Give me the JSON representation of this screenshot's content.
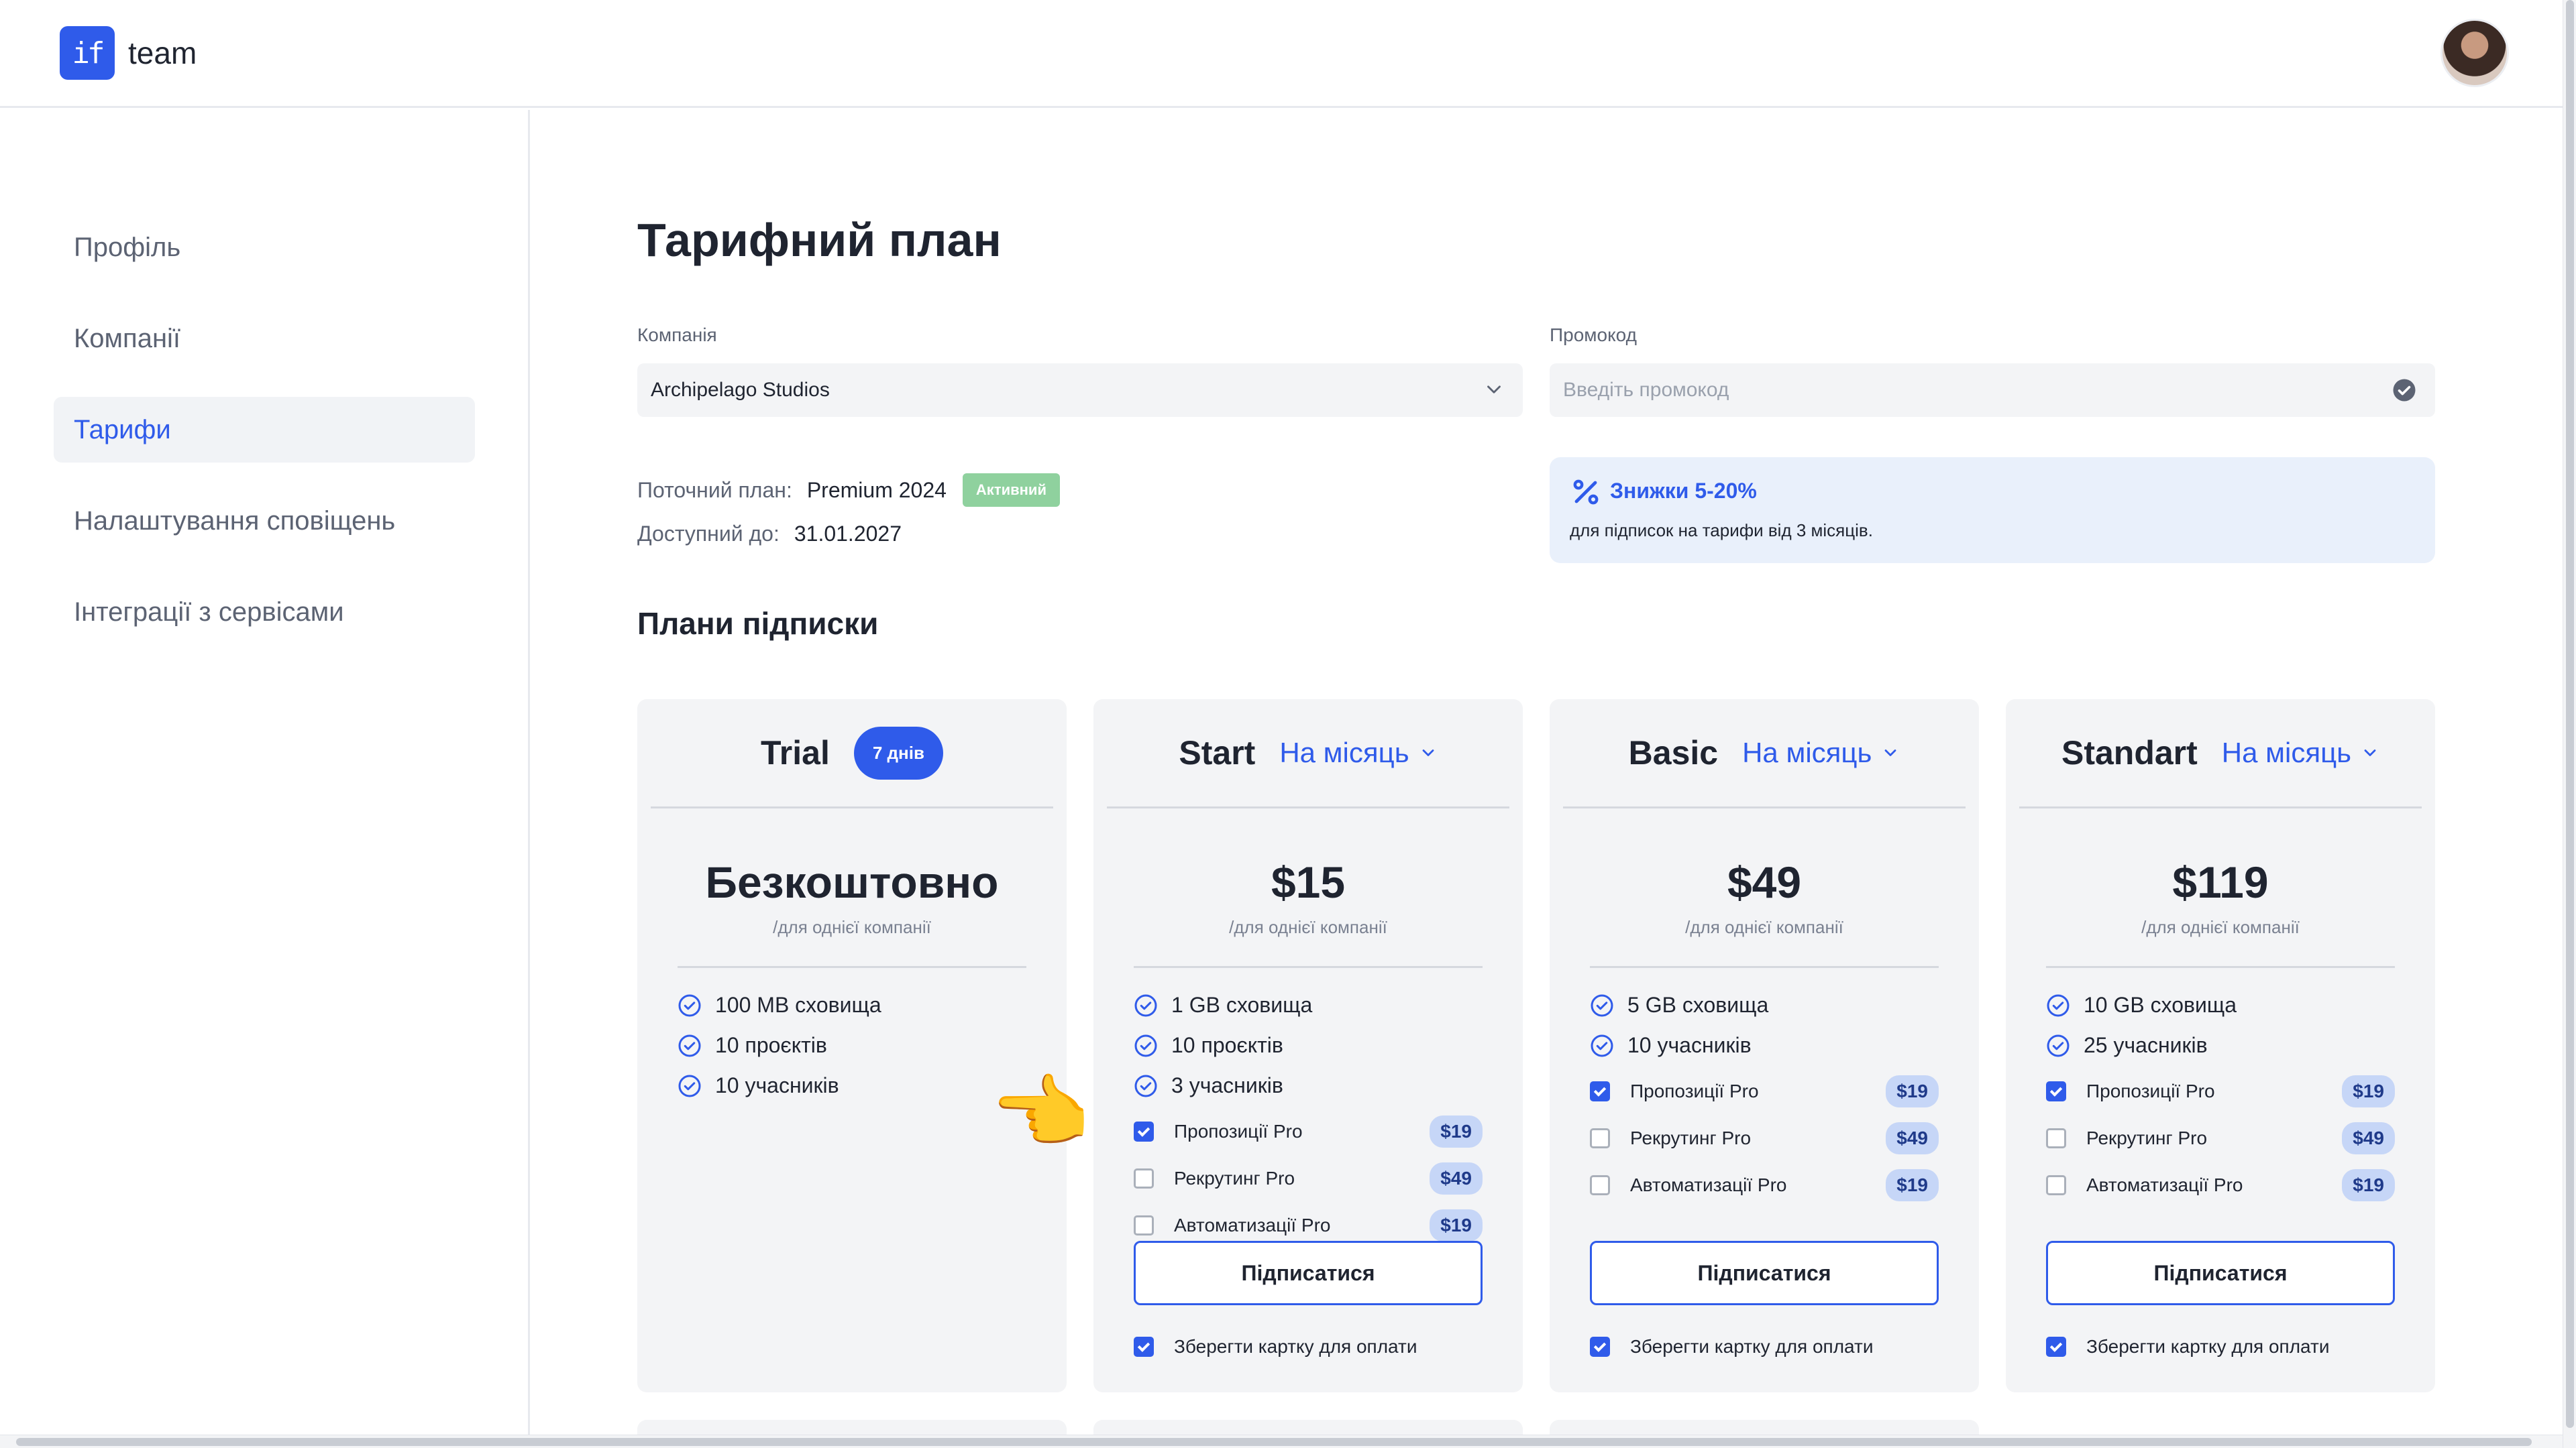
{
  "app": {
    "logo_mark": "if",
    "logo_text": "team"
  },
  "sidebar": {
    "items": [
      {
        "label": "Профіль"
      },
      {
        "label": "Компанії"
      },
      {
        "label": "Тарифи"
      },
      {
        "label": "Налаштування сповіщень"
      },
      {
        "label": "Інтеграції з сервісами"
      }
    ]
  },
  "main": {
    "title": "Тарифний план",
    "company": {
      "label": "Компанія",
      "value": "Archipelago Studios"
    },
    "promo": {
      "label": "Промокод",
      "placeholder": "Введіть промокод"
    },
    "current_plan": {
      "label": "Поточний план:",
      "value": "Premium 2024",
      "status": "Активний"
    },
    "available_until": {
      "label": "Доступний до:",
      "value": "31.01.2027"
    },
    "discount": {
      "title": "Знижки 5-20%",
      "description": "для підписок на тарифи від 3 місяців."
    },
    "plans_title": "Плани підписки"
  },
  "plans": [
    {
      "name": "Trial",
      "badge": "7 днів",
      "price": "Безкоштовно",
      "per": "/для однієї компанії",
      "features": [
        "100 MB сховища",
        "10 проєктів",
        "10 учасників"
      ]
    },
    {
      "name": "Start",
      "period": "На місяць",
      "price": "$15",
      "per": "/для однієї компанії",
      "features": [
        "1 GB сховища",
        "10 проєктів",
        "3 учасників"
      ],
      "addons": [
        {
          "label": "Пропозиції Pro",
          "price": "$19",
          "checked": true
        },
        {
          "label": "Рекрутинг Pro",
          "price": "$49",
          "checked": false
        },
        {
          "label": "Автоматизації Pro",
          "price": "$19",
          "checked": false
        }
      ],
      "subscribe": "Підписатися",
      "save_card": "Зберегти картку для оплати"
    },
    {
      "name": "Basic",
      "period": "На місяць",
      "price": "$49",
      "per": "/для однієї компанії",
      "features": [
        "5 GB сховища",
        "10 учасників"
      ],
      "addons": [
        {
          "label": "Пропозиції Pro",
          "price": "$19",
          "checked": true
        },
        {
          "label": "Рекрутинг Pro",
          "price": "$49",
          "checked": false
        },
        {
          "label": "Автоматизації Pro",
          "price": "$19",
          "checked": false
        }
      ],
      "subscribe": "Підписатися",
      "save_card": "Зберегти картку для оплати"
    },
    {
      "name": "Standart",
      "period": "На місяць",
      "price": "$119",
      "per": "/для однієї компанії",
      "features": [
        "10 GB сховища",
        "25 учасників"
      ],
      "addons": [
        {
          "label": "Пропозиції Pro",
          "price": "$19",
          "checked": true
        },
        {
          "label": "Рекрутинг Pro",
          "price": "$49",
          "checked": false
        },
        {
          "label": "Автоматизації Pro",
          "price": "$19",
          "checked": false
        }
      ],
      "subscribe": "Підписатися",
      "save_card": "Зберегти картку для оплати"
    }
  ],
  "overlay": {
    "pointer_emoji": "👉"
  },
  "colors": {
    "accent": "#2f5bea",
    "active_badge": "#8fd19e",
    "card_bg": "#f3f4f6",
    "discount_bg": "#e9f0fb"
  }
}
